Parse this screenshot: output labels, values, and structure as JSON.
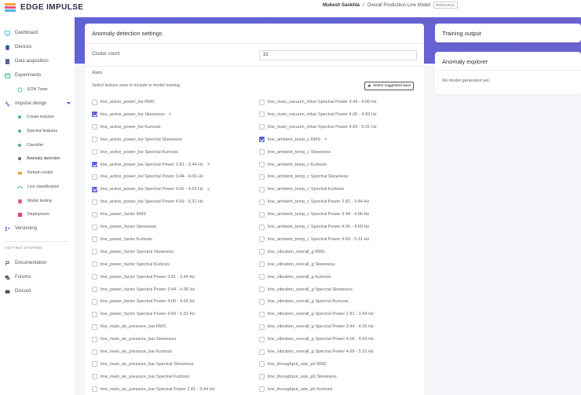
{
  "app": {
    "logo_text": "EDGE IMPULSE"
  },
  "breadcrumb": {
    "user": "Mukesh Sankhla",
    "separator": "/",
    "project": "Overall Production Line Model",
    "badge": "PERSONAL"
  },
  "sidebar": {
    "items": [
      {
        "label": "Dashboard",
        "icon": "monitor-icon"
      },
      {
        "label": "Devices",
        "icon": "device-icon"
      },
      {
        "label": "Data acquisition",
        "icon": "database-icon"
      },
      {
        "label": "Experiments",
        "icon": "experiments-icon"
      },
      {
        "label": "EON Tuner",
        "icon": "tuner-icon"
      },
      {
        "label": "Impulse design",
        "icon": "impulse-icon"
      },
      {
        "label": "Create impulse",
        "icon": "dot-icon"
      },
      {
        "label": "Spectral features",
        "icon": "dot-icon"
      },
      {
        "label": "Classifier",
        "icon": "dot-icon"
      },
      {
        "label": "Anomaly detection",
        "icon": "dot-icon"
      },
      {
        "label": "Retrain model",
        "icon": "retrain-icon"
      },
      {
        "label": "Live classification",
        "icon": "live-icon"
      },
      {
        "label": "Model testing",
        "icon": "testing-icon"
      },
      {
        "label": "Deployment",
        "icon": "deployment-icon"
      },
      {
        "label": "Versioning",
        "icon": "versioning-icon"
      }
    ],
    "getting_started_label": "GETTING STARTED",
    "getting_started": [
      {
        "label": "Documentation",
        "icon": "docs-icon"
      },
      {
        "label": "Forums",
        "icon": "forums-icon"
      },
      {
        "label": "Discord",
        "icon": "discord-icon"
      }
    ]
  },
  "colors": {
    "accent": "#5b60d8",
    "band": "#6064d4",
    "sidebar_active": "#5b60d8"
  },
  "anomaly_settings": {
    "title": "Anomaly detection settings",
    "cluster_count_label": "Cluster count",
    "cluster_count_value": "32",
    "axes_label": "Axes",
    "axes_help": "Select feature axes to include in model training.",
    "suggest_button": "Select suggested axes",
    "axes_left": [
      {
        "label": "line_active_power_kw RMS",
        "checked": false,
        "star": false
      },
      {
        "label": "line_active_power_kw Skewness",
        "checked": true,
        "star": true
      },
      {
        "label": "line_active_power_kw Kurtosis",
        "checked": false,
        "star": false
      },
      {
        "label": "line_active_power_kw Spectral Skewness",
        "checked": false,
        "star": false
      },
      {
        "label": "line_active_power_kw Spectral Kurtosis",
        "checked": false,
        "star": false
      },
      {
        "label": "line_active_power_kw Spectral Power 2.81 - 3.44 Hz",
        "checked": true,
        "star": true
      },
      {
        "label": "line_active_power_kw Spectral Power 3.44 - 4.06 Hz",
        "checked": false,
        "star": false
      },
      {
        "label": "line_active_power_kw Spectral Power 4.06 - 4.69 Hz",
        "checked": true,
        "star": true
      },
      {
        "label": "line_active_power_kw Spectral Power 4.69 - 5.31 Hz",
        "checked": false,
        "star": false
      },
      {
        "label": "line_power_factor RMS",
        "checked": false,
        "star": false
      },
      {
        "label": "line_power_factor Skewness",
        "checked": false,
        "star": false
      },
      {
        "label": "line_power_factor Kurtosis",
        "checked": false,
        "star": false
      },
      {
        "label": "line_power_factor Spectral Skewness",
        "checked": false,
        "star": false
      },
      {
        "label": "line_power_factor Spectral Kurtosis",
        "checked": false,
        "star": false
      },
      {
        "label": "line_power_factor Spectral Power 2.81 - 3.44 Hz",
        "checked": false,
        "star": false
      },
      {
        "label": "line_power_factor Spectral Power 3.44 - 4.06 Hz",
        "checked": false,
        "star": false
      },
      {
        "label": "line_power_factor Spectral Power 4.06 - 4.69 Hz",
        "checked": false,
        "star": false
      },
      {
        "label": "line_power_factor Spectral Power 4.69 - 5.31 Hz",
        "checked": false,
        "star": false
      },
      {
        "label": "line_main_air_pressure_bar RMS",
        "checked": false,
        "star": false
      },
      {
        "label": "line_main_air_pressure_bar Skewness",
        "checked": false,
        "star": false
      },
      {
        "label": "line_main_air_pressure_bar Kurtosis",
        "checked": false,
        "star": false
      },
      {
        "label": "line_main_air_pressure_bar Spectral Skewness",
        "checked": false,
        "star": false
      },
      {
        "label": "line_main_air_pressure_bar Spectral Kurtosis",
        "checked": false,
        "star": false
      },
      {
        "label": "line_main_air_pressure_bar Spectral Power 2.81 - 3.44 Hz",
        "checked": false,
        "star": false
      }
    ],
    "axes_right": [
      {
        "label": "line_main_vacuum_mbar Spectral Power 3.44 - 4.06 Hz",
        "checked": false,
        "star": false
      },
      {
        "label": "line_main_vacuum_mbar Spectral Power 4.06 - 4.69 Hz",
        "checked": false,
        "star": false
      },
      {
        "label": "line_main_vacuum_mbar Spectral Power 4.69 - 5.31 Hz",
        "checked": false,
        "star": false
      },
      {
        "label": "line_ambient_temp_c RMS",
        "checked": true,
        "star": true
      },
      {
        "label": "line_ambient_temp_c Skewness",
        "checked": false,
        "star": false
      },
      {
        "label": "line_ambient_temp_c Kurtosis",
        "checked": false,
        "star": false
      },
      {
        "label": "line_ambient_temp_c Spectral Skewness",
        "checked": false,
        "star": false
      },
      {
        "label": "line_ambient_temp_c Spectral Kurtosis",
        "checked": false,
        "star": false
      },
      {
        "label": "line_ambient_temp_c Spectral Power 2.81 - 3.44 Hz",
        "checked": false,
        "star": false
      },
      {
        "label": "line_ambient_temp_c Spectral Power 3.44 - 4.06 Hz",
        "checked": false,
        "star": false
      },
      {
        "label": "line_ambient_temp_c Spectral Power 4.06 - 4.69 Hz",
        "checked": false,
        "star": false
      },
      {
        "label": "line_ambient_temp_c Spectral Power 4.69 - 5.31 Hz",
        "checked": false,
        "star": false
      },
      {
        "label": "line_vibration_overall_g RMS",
        "checked": false,
        "star": false
      },
      {
        "label": "line_vibration_overall_g Skewness",
        "checked": false,
        "star": false
      },
      {
        "label": "line_vibration_overall_g Kurtosis",
        "checked": false,
        "star": false
      },
      {
        "label": "line_vibration_overall_g Spectral Skewness",
        "checked": false,
        "star": false
      },
      {
        "label": "line_vibration_overall_g Spectral Kurtosis",
        "checked": false,
        "star": false
      },
      {
        "label": "line_vibration_overall_g Spectral Power 2.81 - 3.44 Hz",
        "checked": false,
        "star": false
      },
      {
        "label": "line_vibration_overall_g Spectral Power 3.44 - 4.06 Hz",
        "checked": false,
        "star": false
      },
      {
        "label": "line_vibration_overall_g Spectral Power 4.06 - 4.69 Hz",
        "checked": false,
        "star": false
      },
      {
        "label": "line_vibration_overall_g Spectral Power 4.69 - 5.31 Hz",
        "checked": false,
        "star": false
      },
      {
        "label": "line_throughput_rate_ph RMS",
        "checked": false,
        "star": false
      },
      {
        "label": "line_throughput_rate_ph Skewness",
        "checked": false,
        "star": false
      },
      {
        "label": "line_throughput_rate_ph Kurtosis",
        "checked": false,
        "star": false
      }
    ]
  },
  "training_output": {
    "title": "Training output"
  },
  "anomaly_explorer": {
    "title": "Anomaly explorer",
    "empty_text": "No model generated yet."
  }
}
